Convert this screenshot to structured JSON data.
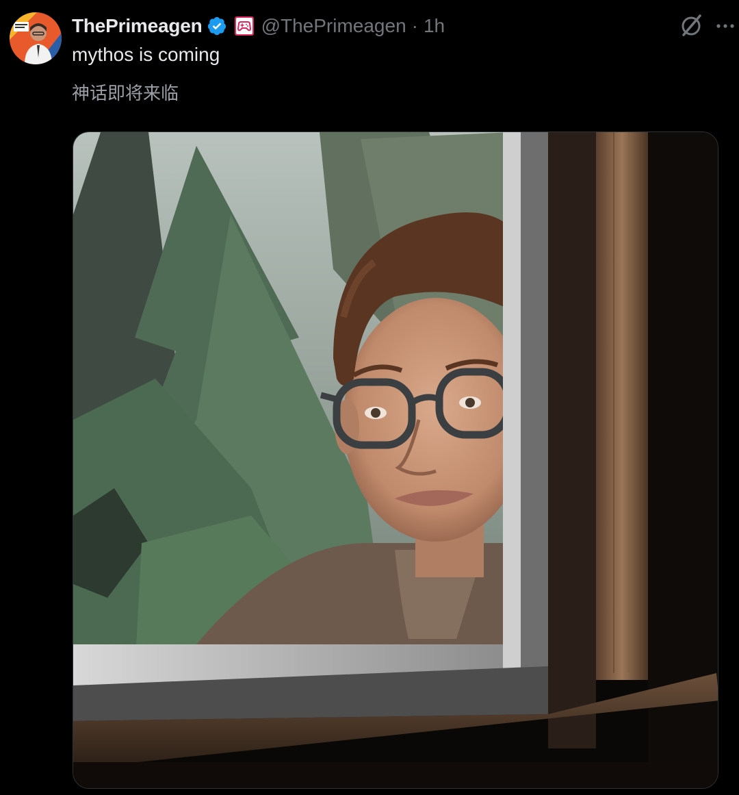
{
  "author": {
    "display_name": "ThePrimeagen",
    "handle": "@ThePrimeagen",
    "time_separator": "·",
    "timestamp": "1h",
    "verified_icon": "verified-badge-icon",
    "affiliate_icon": "gamepad-affiliate-icon",
    "avatar_icon": "avatar"
  },
  "tweet": {
    "text": "mythos is coming",
    "translation": "神话即将来临"
  },
  "actions": {
    "grok_icon": "grok-icon",
    "more_icon": "more-dots-icon"
  },
  "media": {
    "type": "image"
  },
  "colors": {
    "background": "#000000",
    "text_primary": "#e7e9ea",
    "text_secondary": "#71767b",
    "verified_blue": "#1d9bf0",
    "affiliate_red": "#e0245e"
  }
}
